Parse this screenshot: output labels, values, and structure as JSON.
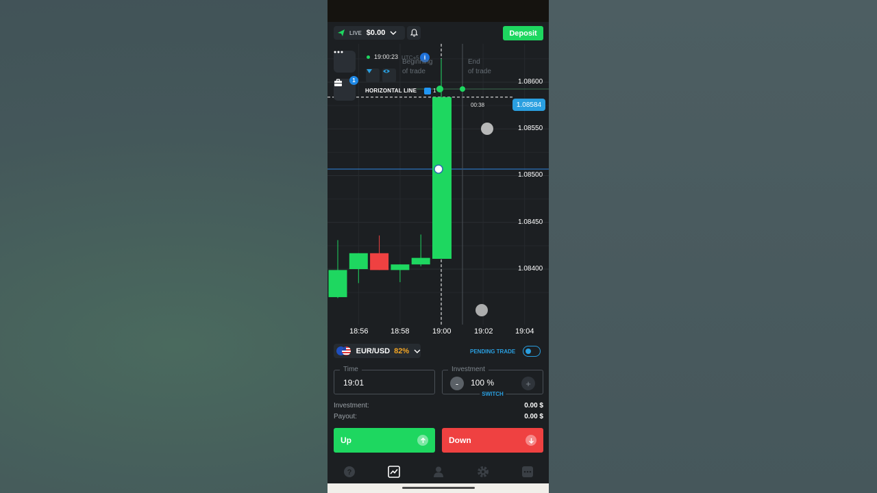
{
  "colors": {
    "accent_green": "#1ed760",
    "accent_red": "#ef4141",
    "accent_blue": "#2a9fe0",
    "payout_orange": "#f5a623",
    "panel_bg": "#1c1f22"
  },
  "header": {
    "account_mode": "LIVE",
    "balance": "$0.00",
    "deposit_label": "Deposit",
    "icons": [
      "paper-plane-icon",
      "chevron-down-icon",
      "bell-icon"
    ]
  },
  "chart": {
    "clock": "19:00:23",
    "timezone": "UTC+5",
    "info_badge": "i",
    "tools_badge": "1",
    "beginning_label_1": "Beginning",
    "beginning_label_2": "of trade",
    "end_label_1": "End",
    "end_label_2": "of trade",
    "drawing_label": "HORIZONTAL LINE",
    "drawing_count": "1",
    "current_price_tag": "1.08584",
    "countdown": "00:38",
    "price_levels": [
      "1.08600",
      "1.08550",
      "1.08500",
      "1.08450",
      "1.08400"
    ],
    "time_labels": [
      "18:56",
      "18:58",
      "19:00",
      "19:02",
      "19:04"
    ]
  },
  "chart_data": {
    "type": "candlestick",
    "x_unit": "time (1-minute candles)",
    "ylim": [
      1.0837,
      1.0863
    ],
    "candles": [
      {
        "time": "18:55",
        "open": 1.0837,
        "close": 1.08399,
        "high": 1.08431,
        "low": 1.08369,
        "color": "green"
      },
      {
        "time": "18:56",
        "open": 1.084,
        "close": 1.08417,
        "high": 1.08417,
        "low": 1.08385,
        "color": "green"
      },
      {
        "time": "18:57",
        "open": 1.08417,
        "close": 1.08399,
        "high": 1.08436,
        "low": 1.08399,
        "color": "red"
      },
      {
        "time": "18:58",
        "open": 1.08399,
        "close": 1.08405,
        "high": 1.08405,
        "low": 1.08386,
        "color": "green"
      },
      {
        "time": "18:59",
        "open": 1.08405,
        "close": 1.08412,
        "high": 1.08437,
        "low": 1.08403,
        "color": "green"
      },
      {
        "time": "19:00",
        "open": 1.08411,
        "close": 1.08584,
        "high": 1.08625,
        "low": 1.08411,
        "color": "green"
      }
    ],
    "horizontal_line": 1.086,
    "blue_level": 1.08507,
    "current_price": 1.08584
  },
  "trade": {
    "asset": "EUR/USD",
    "payout_percent": "82%",
    "pending_label": "PENDING TRADE",
    "time_legend": "Time",
    "time_value": "19:01",
    "investment_legend": "Investment",
    "investment_value": "100 %",
    "minus": "-",
    "plus": "+",
    "switch_label": "SWITCH",
    "investment_label": "Investment:",
    "investment_amount": "0.00 $",
    "payout_label": "Payout:",
    "payout_amount": "0.00 $",
    "up_label": "Up",
    "down_label": "Down"
  },
  "nav": {
    "items": [
      "help-icon",
      "chart-icon",
      "profile-icon",
      "settings-icon",
      "more-icon"
    ],
    "active": "chart-icon"
  }
}
